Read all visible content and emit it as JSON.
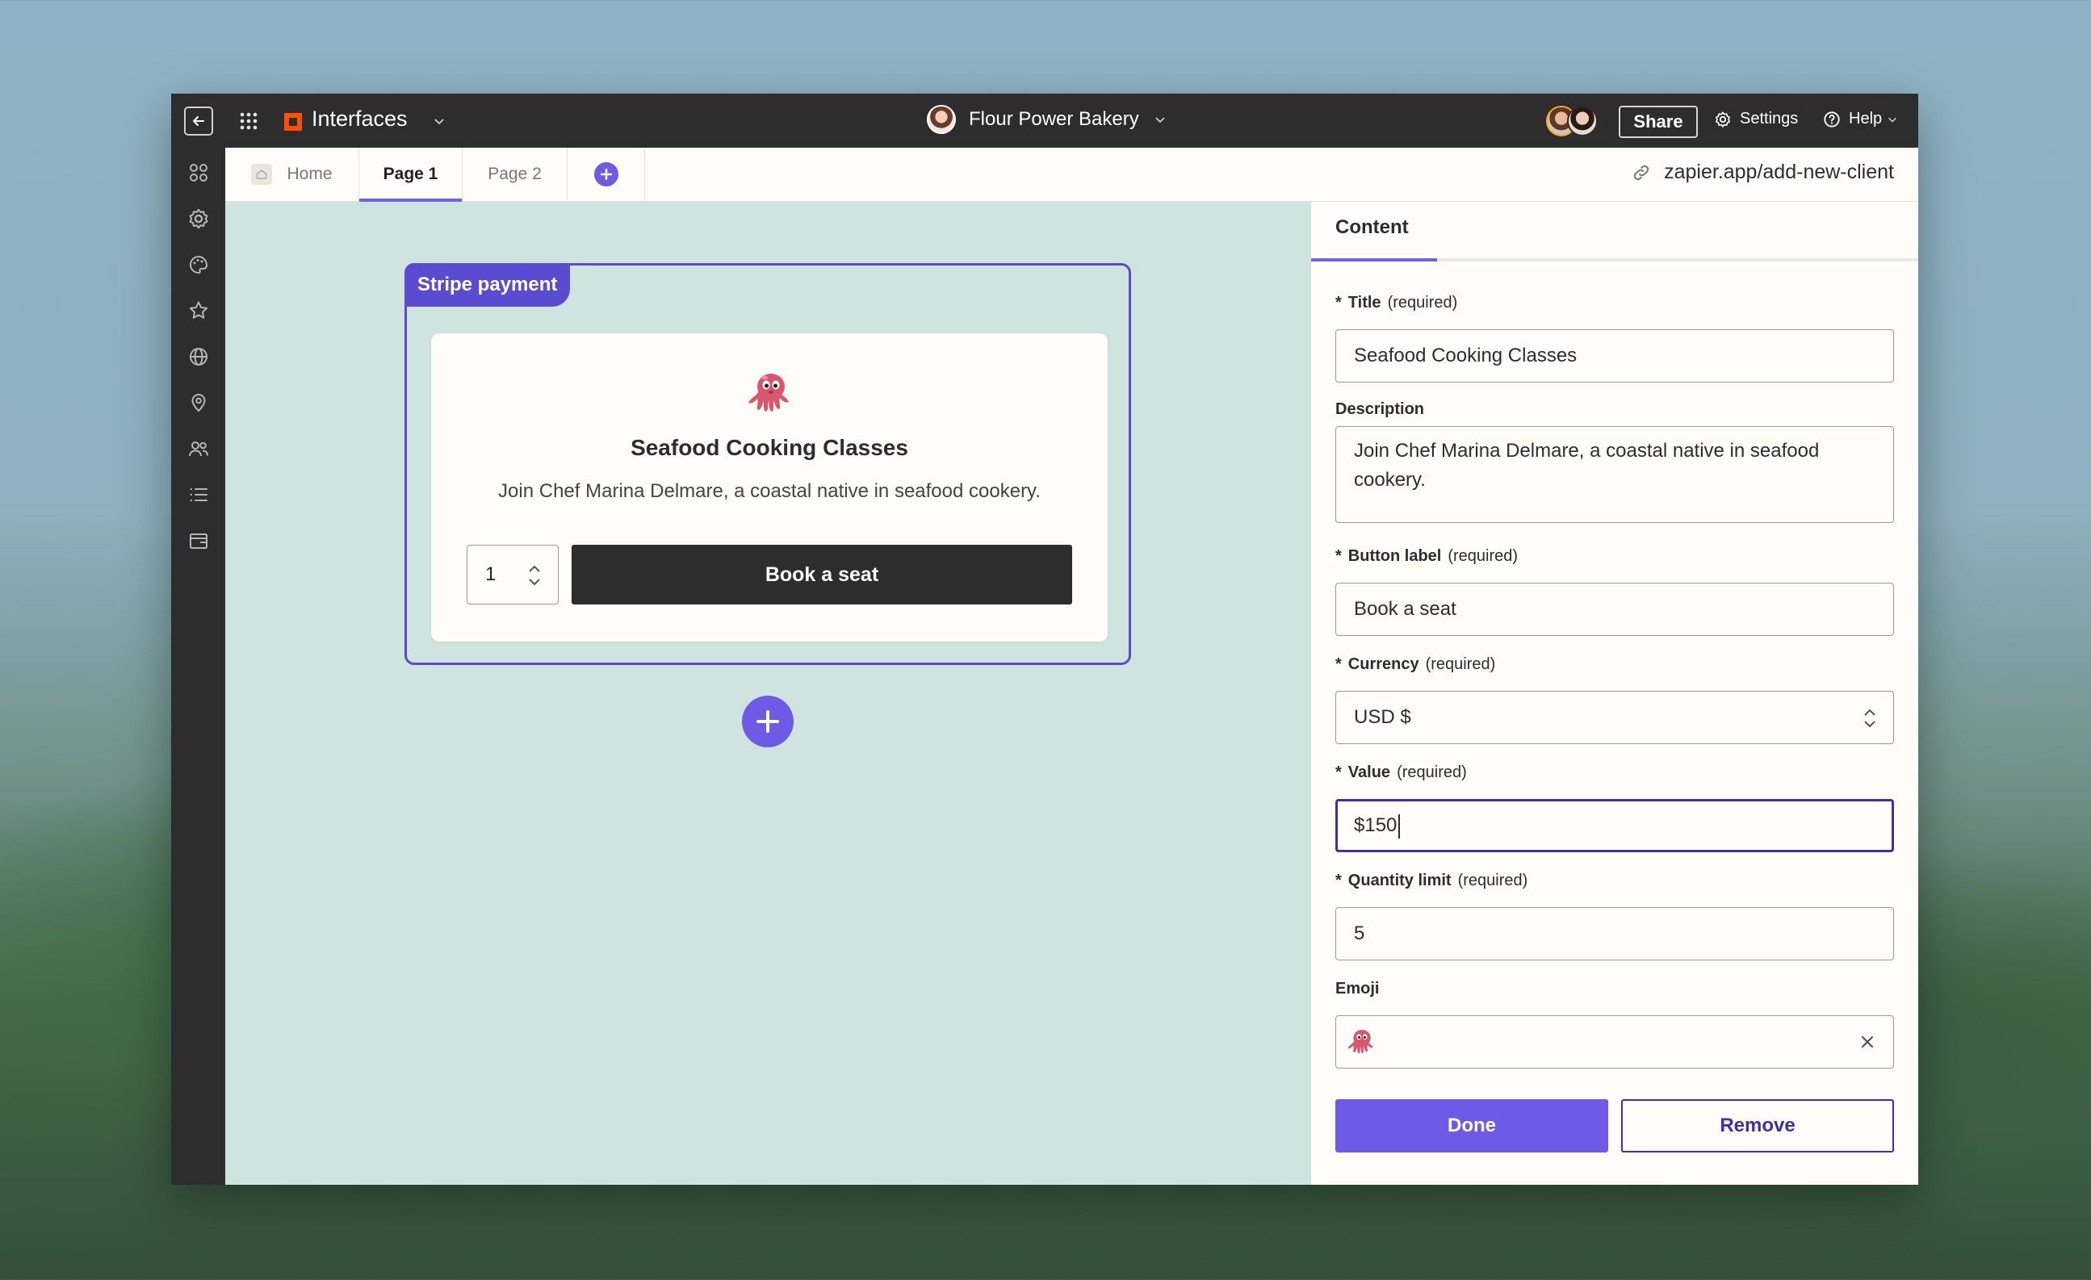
{
  "app": {
    "name": "Interfaces",
    "workspace": "Flour Power Bakery",
    "share_label": "Share",
    "settings_label": "Settings",
    "help_label": "Help",
    "accent": "#6e5ae6",
    "brand": "#ff4f00"
  },
  "tabs": [
    {
      "label": "Home"
    },
    {
      "label": "Page 1",
      "active": true
    },
    {
      "label": "Page 2"
    }
  ],
  "url": "zapier.app/add-new-client",
  "block": {
    "tag": "Stripe payment",
    "title": "Seafood Cooking Classes",
    "description": "Join Chef Marina Delmare, a coastal native in seafood cookery.",
    "quantity": "1",
    "button_label": "Book a seat",
    "emoji": "octopus"
  },
  "panel": {
    "tab": "Content",
    "required_text": "(required)",
    "fields": {
      "title": {
        "label": "Title",
        "value": "Seafood Cooking Classes"
      },
      "description": {
        "label": "Description",
        "value": "Join Chef Marina Delmare, a coastal native in seafood cookery."
      },
      "button_label": {
        "label": "Button label",
        "value": "Book a seat"
      },
      "currency": {
        "label": "Currency",
        "value": "USD $"
      },
      "value": {
        "label": "Value",
        "value": "$150"
      },
      "quantity_limit": {
        "label": "Quantity limit",
        "value": "5"
      },
      "emoji": {
        "label": "Emoji",
        "value": "octopus"
      }
    },
    "done_label": "Done",
    "remove_label": "Remove"
  }
}
